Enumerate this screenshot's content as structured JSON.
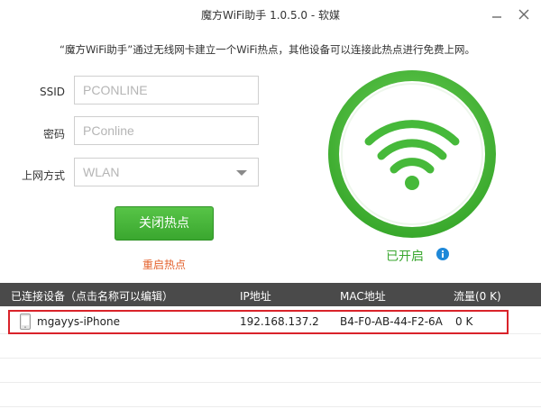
{
  "window": {
    "title": "魔方WiFi助手 1.0.5.0 - 软媒",
    "description": "“魔方WiFi助手”通过无线网卡建立一个WiFi热点，其他设备可以连接此热点进行免费上网。"
  },
  "form": {
    "ssid_label": "SSID",
    "ssid_value": "PCONLINE",
    "password_label": "密码",
    "password_value": "PConline",
    "network_label": "上网方式",
    "network_value": "WLAN"
  },
  "actions": {
    "close_hotspot": "关闭热点",
    "restart_hotspot": "重启热点"
  },
  "status": {
    "text": "已开启",
    "accent_color": "#3aa72f"
  },
  "devices": {
    "headers": {
      "name": "已连接设备（点击名称可以编辑）",
      "ip": "IP地址",
      "mac": "MAC地址",
      "traffic": "流量(0 K)"
    },
    "rows": [
      {
        "name": "mgayys-iPhone",
        "ip": "192.168.137.2",
        "mac": "B4-F0-AB-44-F2-6A",
        "traffic": "0 K"
      }
    ]
  },
  "icons": {
    "minimize": "minimize-icon",
    "close": "close-icon",
    "wifi": "wifi-icon",
    "info": "info-icon",
    "phone": "phone-icon",
    "dropdown": "chevron-down-icon"
  }
}
